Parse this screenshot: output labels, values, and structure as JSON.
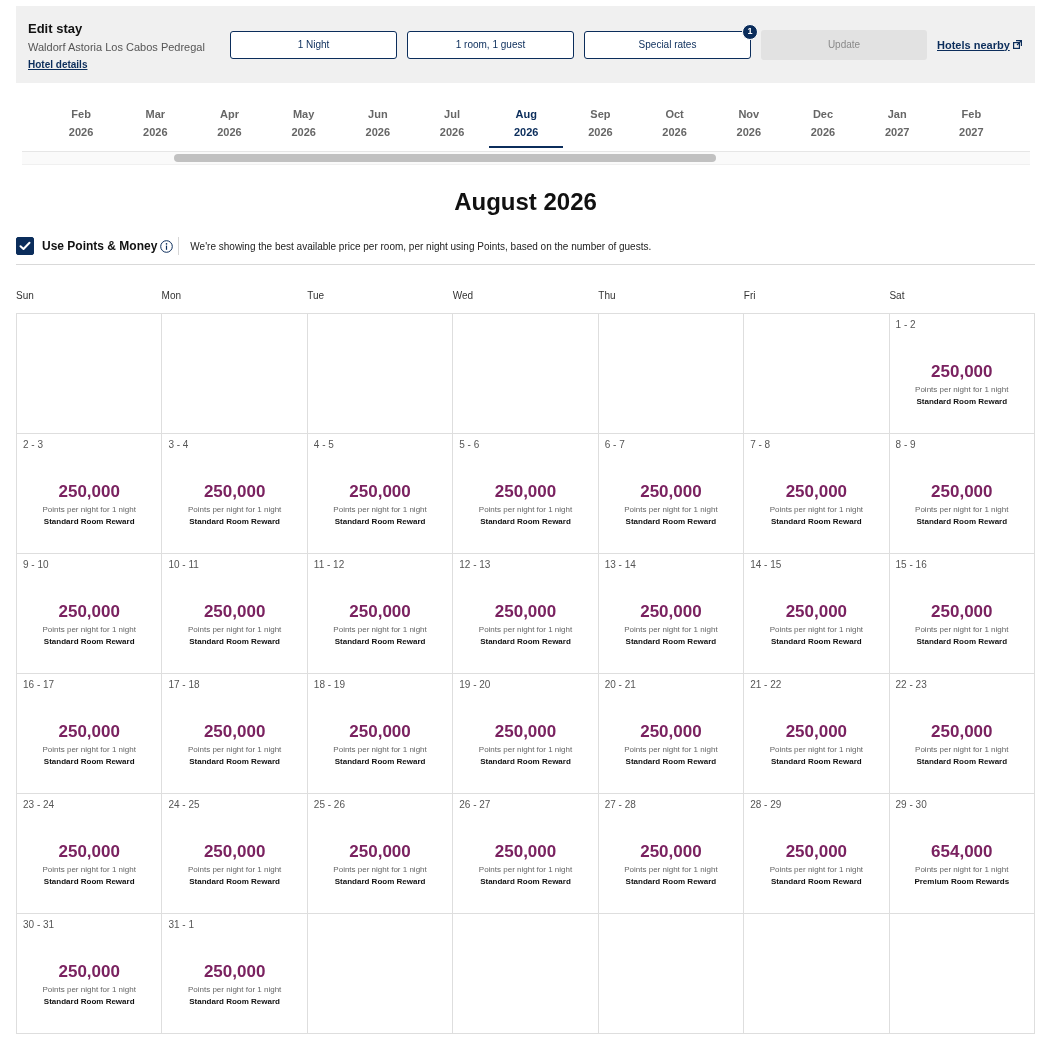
{
  "header": {
    "title": "Edit stay",
    "hotel_name": "Waldorf Astoria Los Cabos Pedregal",
    "details_link": "Hotel details",
    "selectors": [
      {
        "label": "1 Night"
      },
      {
        "label": "1 room, 1 guest"
      },
      {
        "label": "Special rates",
        "badge": "1"
      }
    ],
    "update": {
      "label": "Update",
      "disabled": true
    },
    "nearby_link": "Hotels nearby"
  },
  "months": [
    {
      "month": "Feb",
      "year": "2026",
      "selected": false
    },
    {
      "month": "Mar",
      "year": "2026",
      "selected": false
    },
    {
      "month": "Apr",
      "year": "2026",
      "selected": false
    },
    {
      "month": "May",
      "year": "2026",
      "selected": false
    },
    {
      "month": "Jun",
      "year": "2026",
      "selected": false
    },
    {
      "month": "Jul",
      "year": "2026",
      "selected": false
    },
    {
      "month": "Aug",
      "year": "2026",
      "selected": true
    },
    {
      "month": "Sep",
      "year": "2026",
      "selected": false
    },
    {
      "month": "Oct",
      "year": "2026",
      "selected": false
    },
    {
      "month": "Nov",
      "year": "2026",
      "selected": false
    },
    {
      "month": "Dec",
      "year": "2026",
      "selected": false
    },
    {
      "month": "Jan",
      "year": "2027",
      "selected": false
    },
    {
      "month": "Feb",
      "year": "2027",
      "selected": false
    }
  ],
  "calendar_title": "August 2026",
  "points_option": {
    "label": "Use Points & Money",
    "checked": true,
    "description": "We're showing the best available price per room, per night using Points, based on the number of guests."
  },
  "weekdays": [
    "Sun",
    "Mon",
    "Tue",
    "Wed",
    "Thu",
    "Fri",
    "Sat"
  ],
  "weeks": [
    [
      {
        "kind": "blank"
      },
      {
        "kind": "blank"
      },
      {
        "kind": "blank"
      },
      {
        "kind": "blank"
      },
      {
        "kind": "blank"
      },
      {
        "kind": "blank"
      },
      {
        "kind": "day",
        "dates": "1 - 2",
        "points": "250,000",
        "note": "Points per night for 1 night",
        "rate": "Standard Room Reward"
      }
    ],
    [
      {
        "kind": "day",
        "dates": "2 - 3",
        "points": "250,000",
        "note": "Points per night for 1 night",
        "rate": "Standard Room Reward"
      },
      {
        "kind": "day",
        "dates": "3 - 4",
        "points": "250,000",
        "note": "Points per night for 1 night",
        "rate": "Standard Room Reward"
      },
      {
        "kind": "day",
        "dates": "4 - 5",
        "points": "250,000",
        "note": "Points per night for 1 night",
        "rate": "Standard Room Reward"
      },
      {
        "kind": "day",
        "dates": "5 - 6",
        "points": "250,000",
        "note": "Points per night for 1 night",
        "rate": "Standard Room Reward"
      },
      {
        "kind": "day",
        "dates": "6 - 7",
        "points": "250,000",
        "note": "Points per night for 1 night",
        "rate": "Standard Room Reward"
      },
      {
        "kind": "day",
        "dates": "7 - 8",
        "points": "250,000",
        "note": "Points per night for 1 night",
        "rate": "Standard Room Reward"
      },
      {
        "kind": "day",
        "dates": "8 - 9",
        "points": "250,000",
        "note": "Points per night for 1 night",
        "rate": "Standard Room Reward"
      }
    ],
    [
      {
        "kind": "day",
        "dates": "9 - 10",
        "points": "250,000",
        "note": "Points per night for 1 night",
        "rate": "Standard Room Reward"
      },
      {
        "kind": "day",
        "dates": "10 - 11",
        "points": "250,000",
        "note": "Points per night for 1 night",
        "rate": "Standard Room Reward"
      },
      {
        "kind": "day",
        "dates": "11 - 12",
        "points": "250,000",
        "note": "Points per night for 1 night",
        "rate": "Standard Room Reward"
      },
      {
        "kind": "day",
        "dates": "12 - 13",
        "points": "250,000",
        "note": "Points per night for 1 night",
        "rate": "Standard Room Reward"
      },
      {
        "kind": "day",
        "dates": "13 - 14",
        "points": "250,000",
        "note": "Points per night for 1 night",
        "rate": "Standard Room Reward"
      },
      {
        "kind": "day",
        "dates": "14 - 15",
        "points": "250,000",
        "note": "Points per night for 1 night",
        "rate": "Standard Room Reward"
      },
      {
        "kind": "day",
        "dates": "15 - 16",
        "points": "250,000",
        "note": "Points per night for 1 night",
        "rate": "Standard Room Reward"
      }
    ],
    [
      {
        "kind": "day",
        "dates": "16 - 17",
        "points": "250,000",
        "note": "Points per night for 1 night",
        "rate": "Standard Room Reward"
      },
      {
        "kind": "day",
        "dates": "17 - 18",
        "points": "250,000",
        "note": "Points per night for 1 night",
        "rate": "Standard Room Reward"
      },
      {
        "kind": "day",
        "dates": "18 - 19",
        "points": "250,000",
        "note": "Points per night for 1 night",
        "rate": "Standard Room Reward"
      },
      {
        "kind": "day",
        "dates": "19 - 20",
        "points": "250,000",
        "note": "Points per night for 1 night",
        "rate": "Standard Room Reward"
      },
      {
        "kind": "day",
        "dates": "20 - 21",
        "points": "250,000",
        "note": "Points per night for 1 night",
        "rate": "Standard Room Reward"
      },
      {
        "kind": "day",
        "dates": "21 - 22",
        "points": "250,000",
        "note": "Points per night for 1 night",
        "rate": "Standard Room Reward"
      },
      {
        "kind": "day",
        "dates": "22 - 23",
        "points": "250,000",
        "note": "Points per night for 1 night",
        "rate": "Standard Room Reward"
      }
    ],
    [
      {
        "kind": "day",
        "dates": "23 - 24",
        "points": "250,000",
        "note": "Points per night for 1 night",
        "rate": "Standard Room Reward"
      },
      {
        "kind": "day",
        "dates": "24 - 25",
        "points": "250,000",
        "note": "Points per night for 1 night",
        "rate": "Standard Room Reward"
      },
      {
        "kind": "day",
        "dates": "25 - 26",
        "points": "250,000",
        "note": "Points per night for 1 night",
        "rate": "Standard Room Reward"
      },
      {
        "kind": "day",
        "dates": "26 - 27",
        "points": "250,000",
        "note": "Points per night for 1 night",
        "rate": "Standard Room Reward"
      },
      {
        "kind": "day",
        "dates": "27 - 28",
        "points": "250,000",
        "note": "Points per night for 1 night",
        "rate": "Standard Room Reward"
      },
      {
        "kind": "day",
        "dates": "28 - 29",
        "points": "250,000",
        "note": "Points per night for 1 night",
        "rate": "Standard Room Reward"
      },
      {
        "kind": "day",
        "dates": "29 - 30",
        "points": "654,000",
        "note": "Points per night for 1 night",
        "rate": "Premium Room Rewards"
      }
    ],
    [
      {
        "kind": "day",
        "dates": "30 - 31",
        "points": "250,000",
        "note": "Points per night for 1 night",
        "rate": "Standard Room Reward"
      },
      {
        "kind": "day",
        "dates": "31 - 1",
        "points": "250,000",
        "note": "Points per night for 1 night",
        "rate": "Standard Room Reward"
      },
      {
        "kind": "blank"
      },
      {
        "kind": "blank"
      },
      {
        "kind": "blank"
      },
      {
        "kind": "blank"
      },
      {
        "kind": "blank"
      }
    ]
  ]
}
